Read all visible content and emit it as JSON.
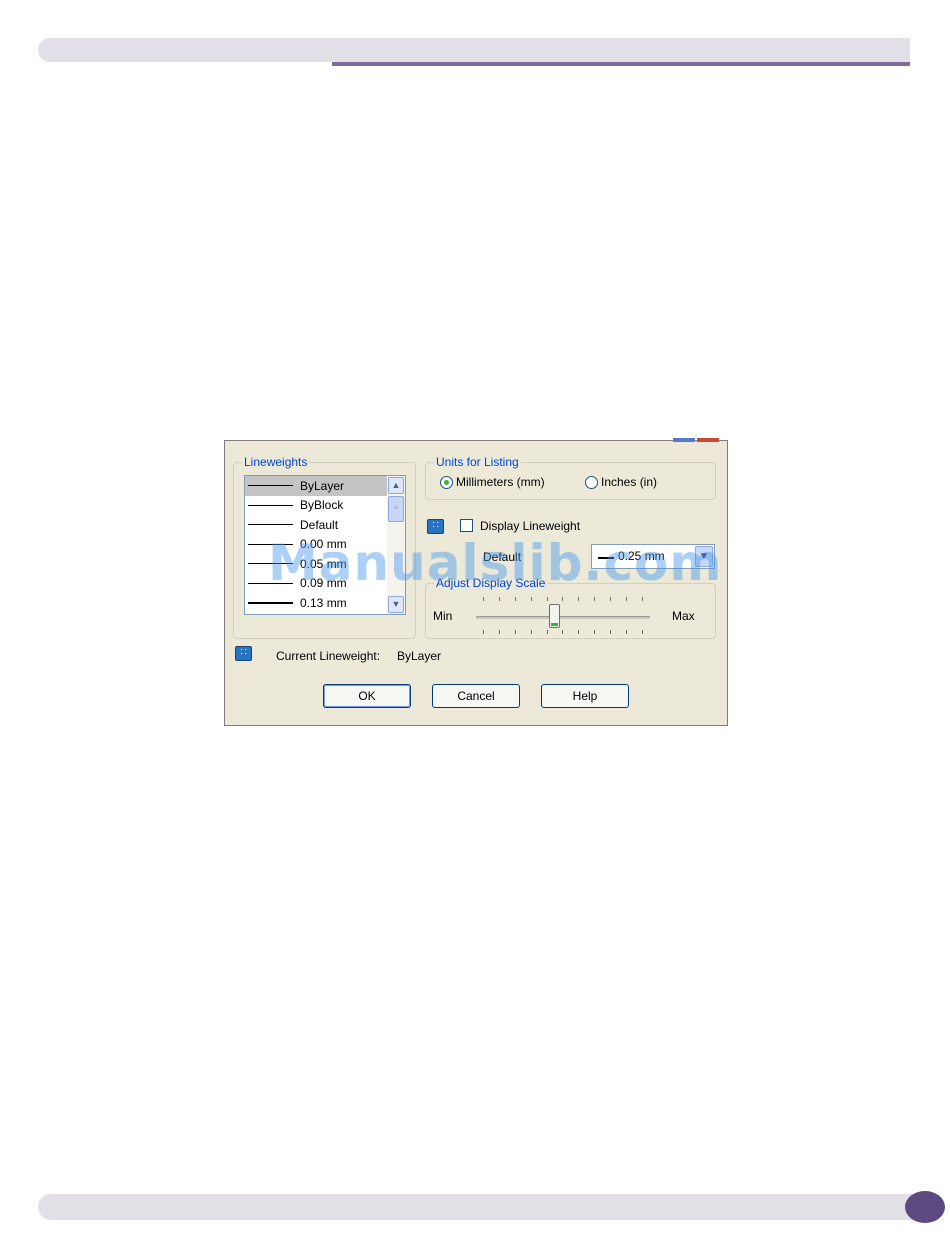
{
  "dialog": {
    "lineweights": {
      "title": "Lineweights",
      "items": [
        {
          "label": "ByLayer",
          "weight": 1,
          "selected": true
        },
        {
          "label": "ByBlock",
          "weight": 1
        },
        {
          "label": "Default",
          "weight": 1
        },
        {
          "label": "0.00 mm",
          "weight": 1
        },
        {
          "label": "0.05 mm",
          "weight": 1
        },
        {
          "label": "0.09 mm",
          "weight": 1
        },
        {
          "label": "0.13 mm",
          "weight": 2
        }
      ]
    },
    "units": {
      "title": "Units for Listing",
      "millimeters_label": "Millimeters (mm)",
      "inches_label": "Inches (in)",
      "selected": "Millimeters (mm)"
    },
    "display_lineweight": {
      "label": "Display Lineweight",
      "checked": false
    },
    "default": {
      "label": "Default",
      "value": "0.25 mm"
    },
    "scale": {
      "title": "Adjust Display Scale",
      "min_label": "Min",
      "max_label": "Max",
      "level_fraction": 0.45
    },
    "current": {
      "label": "Current Lineweight:",
      "value": "ByLayer"
    },
    "buttons": {
      "ok": "OK",
      "cancel": "Cancel",
      "help": "Help"
    }
  },
  "watermark": "Manualslib.com",
  "colors": {
    "page_band": "#e3dfe7",
    "page_accent": "#7d6a9a",
    "group_title": "#0046d5",
    "dialog_bg": "#ece9d8"
  }
}
